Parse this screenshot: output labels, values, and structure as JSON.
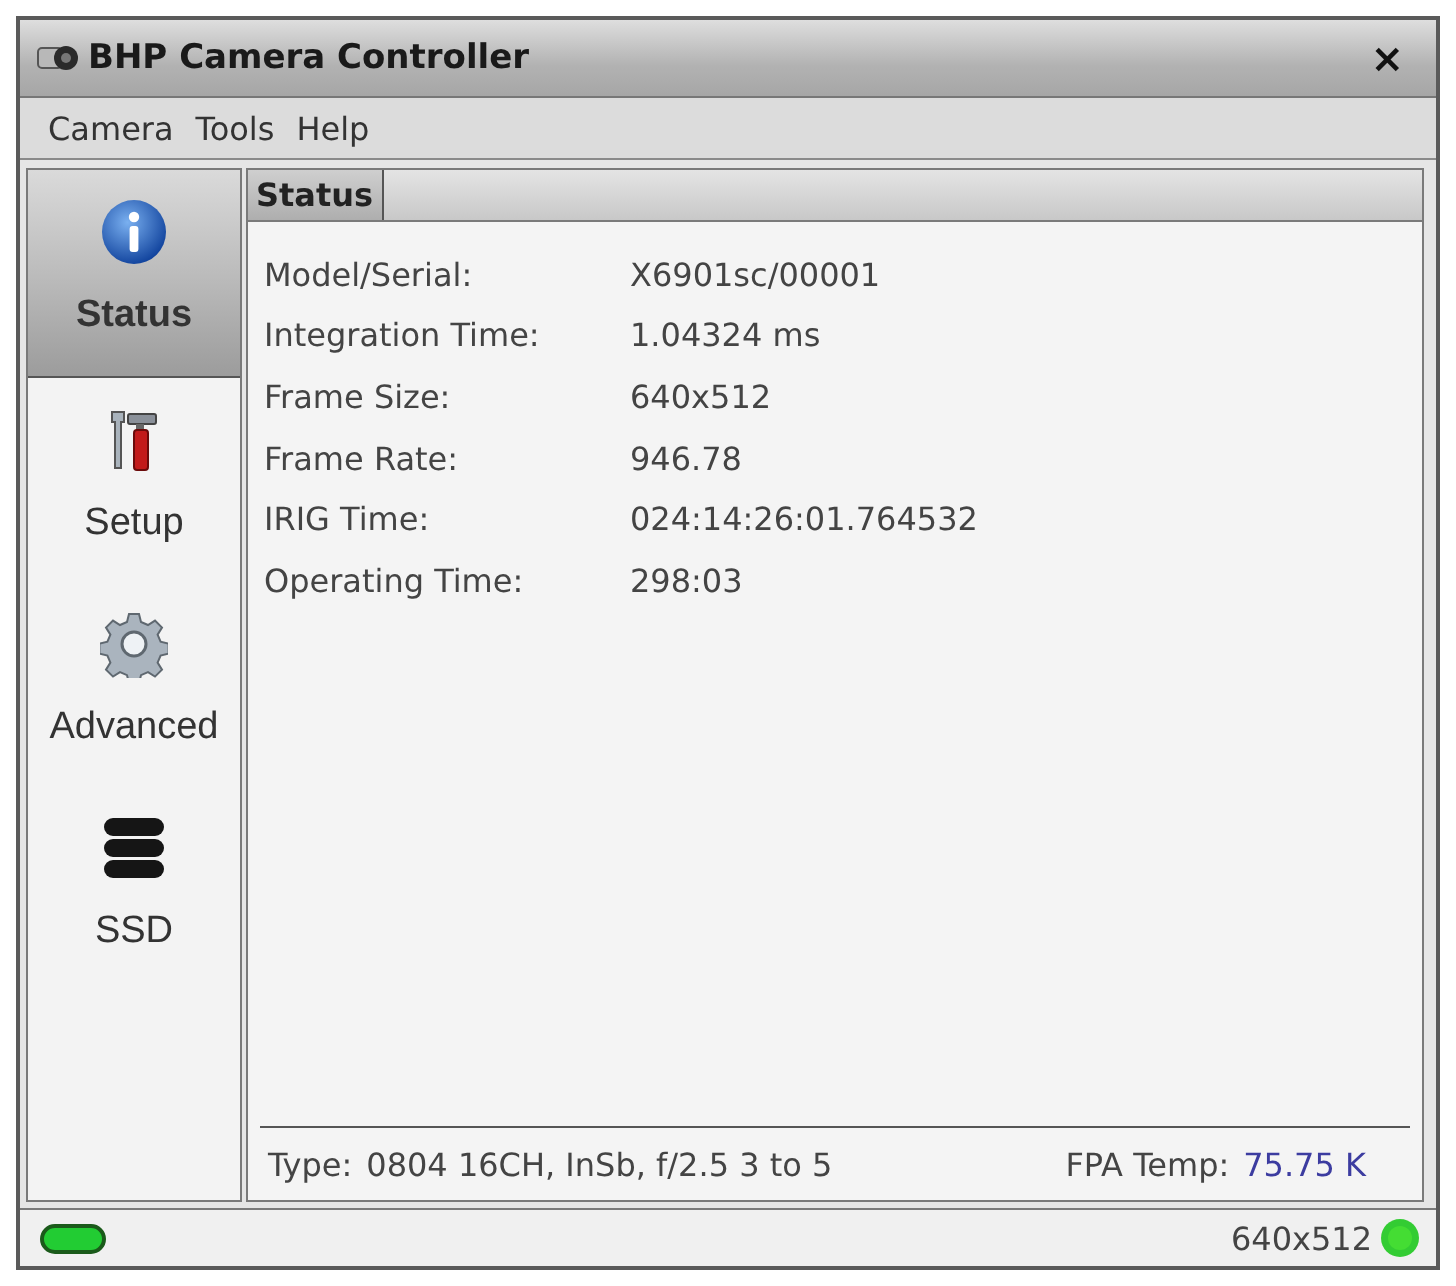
{
  "window": {
    "title": "BHP Camera Controller",
    "close_label": "×"
  },
  "menu": [
    "Camera",
    "Tools",
    "Help"
  ],
  "sidebar": {
    "items": [
      {
        "label": "Status",
        "kind": "info",
        "selected": true
      },
      {
        "label": "Setup",
        "kind": "tools",
        "selected": false
      },
      {
        "label": "Advanced",
        "kind": "gear",
        "selected": false
      },
      {
        "label": "SSD",
        "kind": "disk",
        "selected": false
      }
    ]
  },
  "panel": {
    "tabs": [
      {
        "label": "Status",
        "selected": true
      }
    ],
    "fields": [
      {
        "label": "Model/Serial:",
        "value": "X6901sc/00001"
      },
      {
        "label": "Integration Time:",
        "value": "1.04324 ms"
      },
      {
        "label": "Frame Size:",
        "value": "640x512"
      },
      {
        "label": "Frame Rate:",
        "value": "946.78"
      },
      {
        "label": "IRIG Time:",
        "value": "024:14:26:01.764532"
      },
      {
        "label": "Operating Time:",
        "value": "298:03"
      }
    ],
    "footer": {
      "type_label": "Type:",
      "type_value": "0804 16CH, InSb, f/2.5 3 to 5",
      "fpa_label": "FPA Temp:",
      "fpa_value": "75.75 K"
    }
  },
  "status_bar": {
    "resolution": "640x512"
  }
}
